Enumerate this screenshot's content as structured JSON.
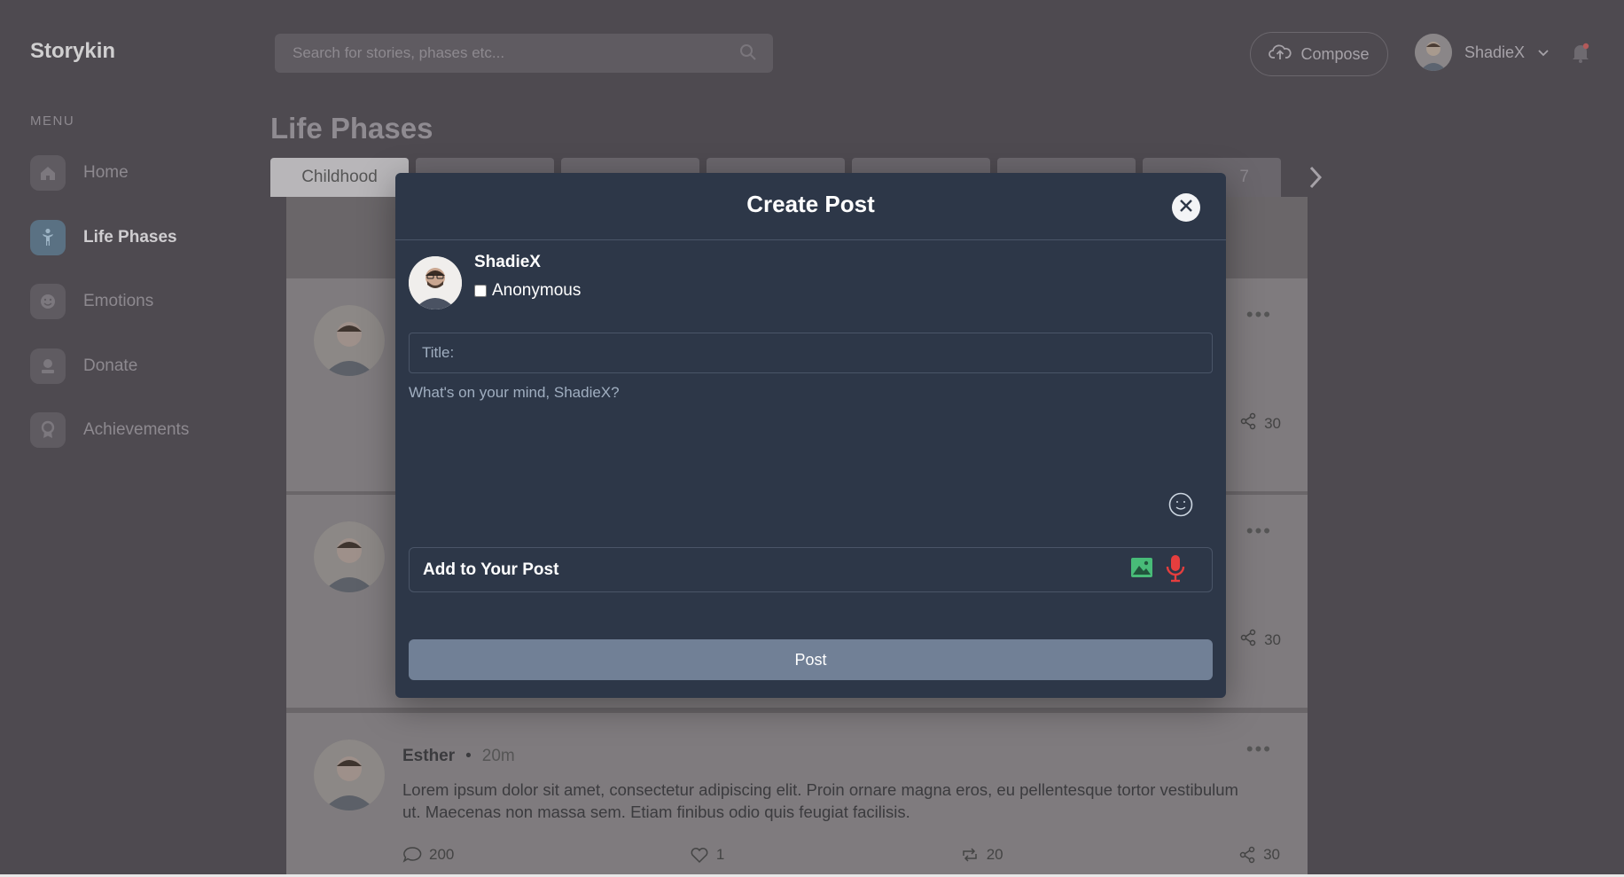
{
  "app": {
    "name": "Storykin"
  },
  "header": {
    "search_placeholder": "Search for stories, phases etc...",
    "compose_label": "Compose",
    "username": "ShadieX"
  },
  "sidebar": {
    "menu_label": "MENU",
    "items": [
      {
        "label": "Home",
        "icon": "home-icon",
        "active": false
      },
      {
        "label": "Life Phases",
        "icon": "life-phases-icon",
        "active": true
      },
      {
        "label": "Emotions",
        "icon": "emotions-icon",
        "active": false
      },
      {
        "label": "Donate",
        "icon": "donate-icon",
        "active": false
      },
      {
        "label": "Achievements",
        "icon": "achievements-icon",
        "active": false
      }
    ]
  },
  "main": {
    "title": "Life Phases",
    "tabs": [
      "Childhood",
      "",
      "",
      "",
      "",
      "",
      "7"
    ]
  },
  "posts": [
    {
      "shares": "30"
    },
    {
      "shares": "30"
    },
    {
      "author": "Esther",
      "time": "20m",
      "body": "Lorem ipsum dolor sit amet, consectetur adipiscing elit. Proin ornare magna eros, eu pellentesque tortor vestibulum ut. Maecenas non massa sem. Etiam finibus odio quis feugiat facilisis.",
      "comments": "200",
      "likes": "1",
      "reposts": "20",
      "shares": "30"
    }
  ],
  "modal": {
    "title": "Create Post",
    "author_name": "ShadieX",
    "anonymous_label": "Anonymous",
    "title_placeholder": "Title:",
    "body_placeholder": "What's on your mind, ShadieX?",
    "add_to_post_label": "Add to Your Post",
    "post_button_label": "Post"
  },
  "colors": {
    "modal_bg": "#2d3748",
    "post_button": "#718096",
    "photo_icon": "#48bb78",
    "mic_icon": "#e53e3e"
  }
}
